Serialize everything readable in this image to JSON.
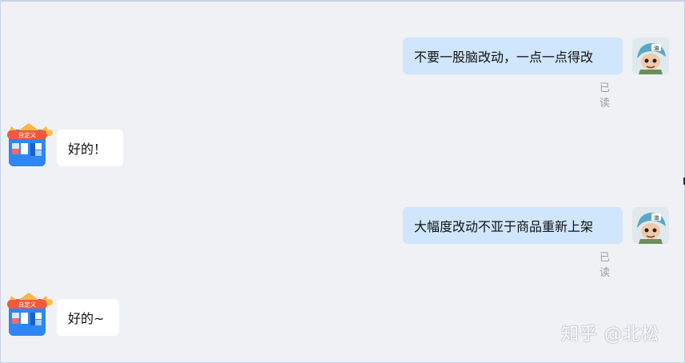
{
  "messages": [
    {
      "direction": "out",
      "text": "不要一股脑改动，一点一点得改",
      "status": "已读"
    },
    {
      "direction": "in",
      "text": "好的！"
    },
    {
      "direction": "out",
      "text": "大幅度改动不亚于商品重新上架",
      "status": "已读"
    },
    {
      "direction": "in",
      "text": "好的~"
    }
  ],
  "bot_badge": "自定义",
  "watermark": "知乎 @北松",
  "colors": {
    "outgoing_bubble": "#cfe6fd",
    "incoming_bubble": "#ffffff",
    "background": "#f0f1f4",
    "bot_avatar": "#2f86f6"
  }
}
